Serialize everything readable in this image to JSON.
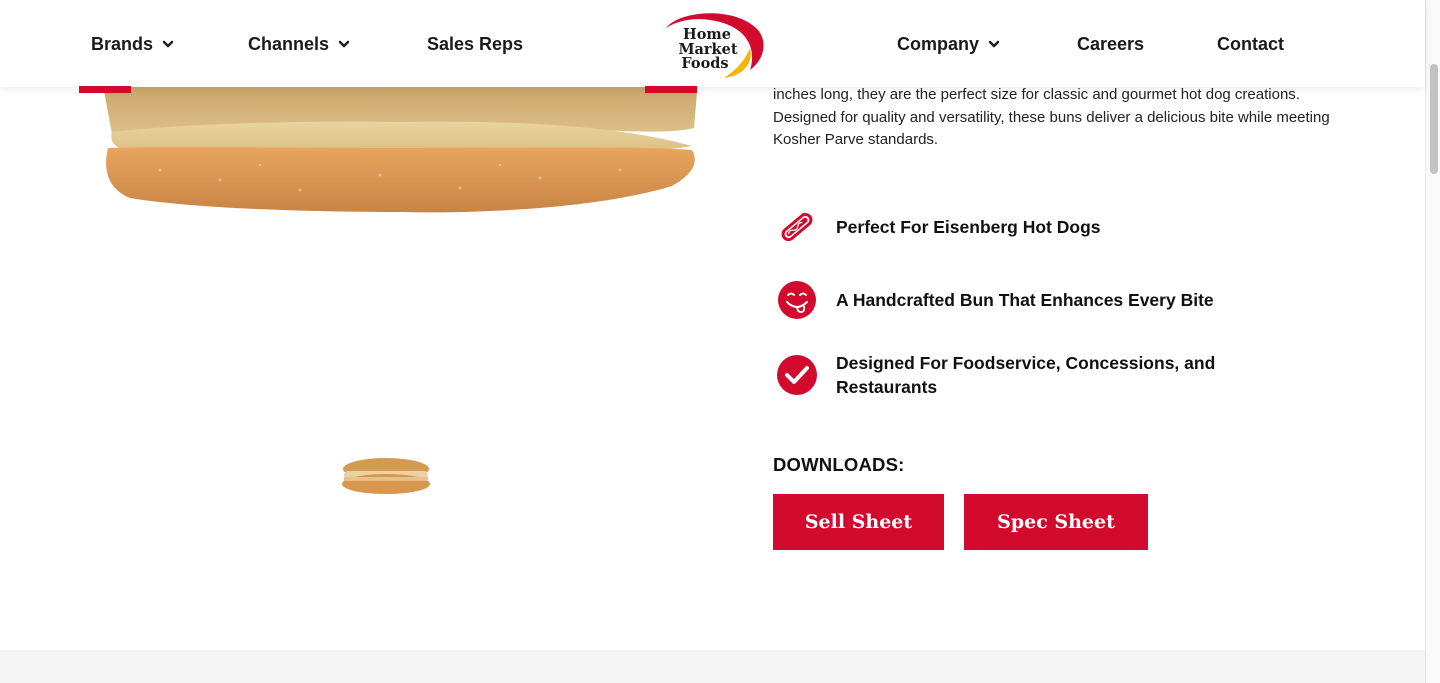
{
  "nav": {
    "brands": "Brands",
    "channels": "Channels",
    "sales_reps": "Sales Reps",
    "company": "Company",
    "careers": "Careers",
    "contact": "Contact"
  },
  "logo": {
    "line1": "Home",
    "line2": "Market",
    "line3": "Foods"
  },
  "product": {
    "description": "inches long, they are the perfect size for classic and gourmet hot dog creations. Designed for quality and versatility, these buns deliver a delicious bite while meeting Kosher Parve standards."
  },
  "features": [
    {
      "icon": "hot-dog-icon",
      "text": "Perfect For Eisenberg Hot Dogs"
    },
    {
      "icon": "smiley-face-icon",
      "text": "A Handcrafted Bun That Enhances Every Bite"
    },
    {
      "icon": "checkmark-icon",
      "text": "Designed For Foodservice, Concessions, and Restaurants"
    }
  ],
  "downloads": {
    "title": "DOWNLOADS:",
    "sell_sheet": "Sell Sheet",
    "spec_sheet": "Spec Sheet"
  },
  "colors": {
    "brand_red": "#d10a2e",
    "logo_yellow": "#f2b705"
  }
}
